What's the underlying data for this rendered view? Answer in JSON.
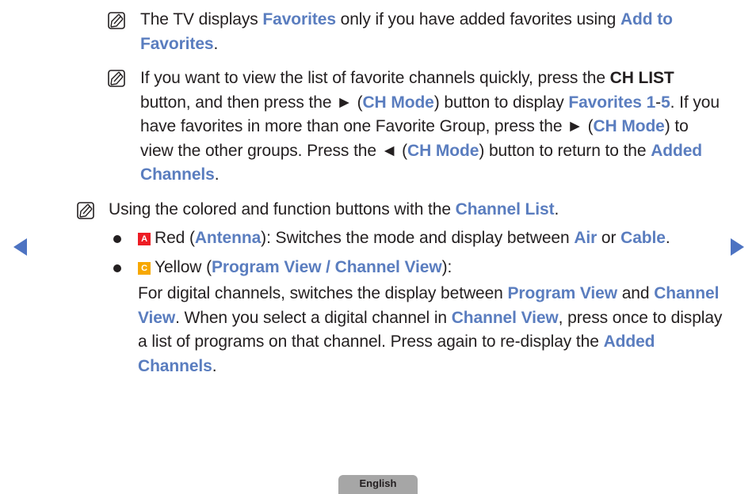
{
  "notes": [
    {
      "icon": "note-pencil-icon",
      "segments": [
        {
          "t": "The TV displays ",
          "s": "n"
        },
        {
          "t": "Favorites",
          "s": "hl"
        },
        {
          "t": " only if you have added favorites using ",
          "s": "n"
        },
        {
          "t": "Add to Favorites",
          "s": "hl"
        },
        {
          "t": ".",
          "s": "n"
        }
      ]
    },
    {
      "icon": "note-pencil-icon",
      "segments": [
        {
          "t": "If you want to view the list of favorite channels quickly, press the ",
          "s": "n"
        },
        {
          "t": "CH LIST",
          "s": "b"
        },
        {
          "t": " button, and then press the ► (",
          "s": "n"
        },
        {
          "t": "CH Mode",
          "s": "hl"
        },
        {
          "t": ") button to display ",
          "s": "n"
        },
        {
          "t": "Favorites 1",
          "s": "hl"
        },
        {
          "t": "-",
          "s": "n"
        },
        {
          "t": "5",
          "s": "hl"
        },
        {
          "t": ". If you have favorites in more than one Favorite Group, press the ► (",
          "s": "n"
        },
        {
          "t": "CH Mode",
          "s": "hl"
        },
        {
          "t": ") to view the other groups. Press the ◄ (",
          "s": "n"
        },
        {
          "t": "CH Mode",
          "s": "hl"
        },
        {
          "t": ") button to return to the ",
          "s": "n"
        },
        {
          "t": "Added Channels",
          "s": "hl"
        },
        {
          "t": ".",
          "s": "n"
        }
      ]
    },
    {
      "icon": "note-pencil-icon",
      "segments": [
        {
          "t": "Using the colored and function buttons with the ",
          "s": "n"
        },
        {
          "t": "Channel List",
          "s": "hl"
        },
        {
          "t": ".",
          "s": "n"
        }
      ]
    }
  ],
  "bullets": [
    {
      "key": {
        "letter": "A",
        "color": "red"
      },
      "segments": [
        {
          "t": "Red (",
          "s": "n"
        },
        {
          "t": "Antenna",
          "s": "hl"
        },
        {
          "t": "): Switches the mode and display between ",
          "s": "n"
        },
        {
          "t": "Air",
          "s": "hl"
        },
        {
          "t": " or ",
          "s": "n"
        },
        {
          "t": "Cable",
          "s": "hl"
        },
        {
          "t": ".",
          "s": "n"
        }
      ]
    },
    {
      "key": {
        "letter": "C",
        "color": "yellow"
      },
      "segments": [
        {
          "t": "Yellow (",
          "s": "n"
        },
        {
          "t": "Program View / Channel View",
          "s": "hl"
        },
        {
          "t": "):",
          "s": "n"
        }
      ],
      "detail": [
        {
          "t": "For digital channels, switches the display between ",
          "s": "n"
        },
        {
          "t": "Program View",
          "s": "hl"
        },
        {
          "t": " and ",
          "s": "n"
        },
        {
          "t": "Channel View",
          "s": "hl"
        },
        {
          "t": ". When you select a digital channel in ",
          "s": "n"
        },
        {
          "t": "Channel View",
          "s": "hl"
        },
        {
          "t": ", press once to display a list of programs on that channel. Press again to re-display the ",
          "s": "n"
        },
        {
          "t": "Added Channels",
          "s": "hl"
        },
        {
          "t": ".",
          "s": "n"
        }
      ]
    }
  ],
  "navigation": {
    "prev": "previous-page",
    "next": "next-page"
  },
  "language_tab": "English",
  "colors": {
    "highlight": "#5a7dbf",
    "text": "#231f20",
    "nav_arrow": "#4d73c2",
    "key_red": "#ed1c24",
    "key_yellow": "#f7a800",
    "tab_bg": "#a6a6a6"
  }
}
